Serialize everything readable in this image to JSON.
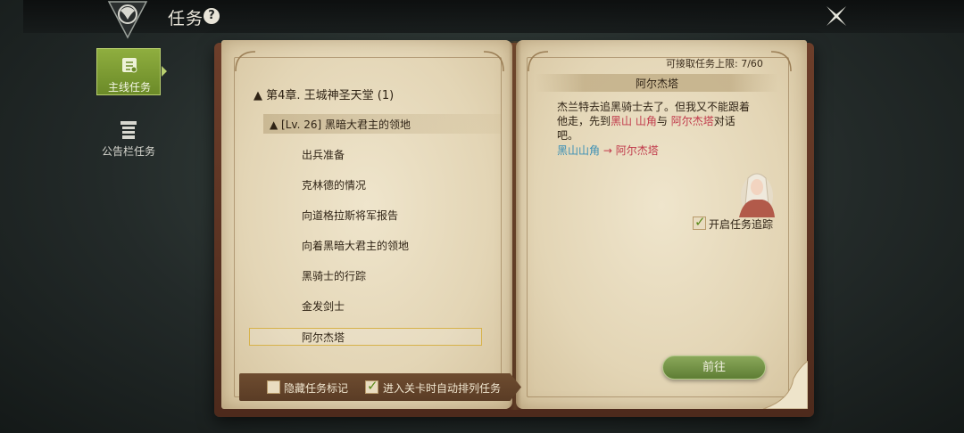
{
  "header": {
    "title": "任务",
    "help_symbol": "?"
  },
  "sidebar": {
    "items": [
      {
        "label": "主线任务",
        "icon": "scroll-icon",
        "active": true
      },
      {
        "label": "公告栏任务",
        "icon": "notice-board-icon",
        "active": false
      }
    ]
  },
  "quest_list": {
    "chapter_label": "▲ 第4章. 王城神圣天堂 (1)",
    "sub_chapter_label": "▲ [Lv. 26] 黑暗大君主的领地",
    "items": [
      "出兵准备",
      "克林德的情况",
      "向道格拉斯将军报告",
      "向着黑暗大君主的领地",
      "黑骑士的行踪",
      "金发剑士",
      "阿尔杰塔"
    ],
    "selected_index": 6
  },
  "options": {
    "hide_markers_label": "隐藏任务标记",
    "hide_markers_checked": false,
    "auto_sort_label": "进入关卡时自动排列任务",
    "auto_sort_checked": true
  },
  "detail": {
    "limit_text": "可接取任务上限: 7/60",
    "quest_title": "阿尔杰塔",
    "desc_part1": "杰兰特去追黑骑士去了。但我又不能跟着他走，先到",
    "desc_place": "黑山 山角",
    "desc_part2": "与",
    "desc_npc": "阿尔杰塔",
    "desc_part3": "对话吧。",
    "route_from": "黑山山角",
    "route_arrow": "→",
    "route_to": "阿尔杰塔",
    "track_label": "开启任务追踪",
    "track_checked": true,
    "go_label": "前往"
  },
  "colors": {
    "accent_green": "#7a9a3a",
    "highlight_red": "#c0394a",
    "route_blue": "#3a8fb5",
    "selection_gold": "#d7b24a"
  }
}
